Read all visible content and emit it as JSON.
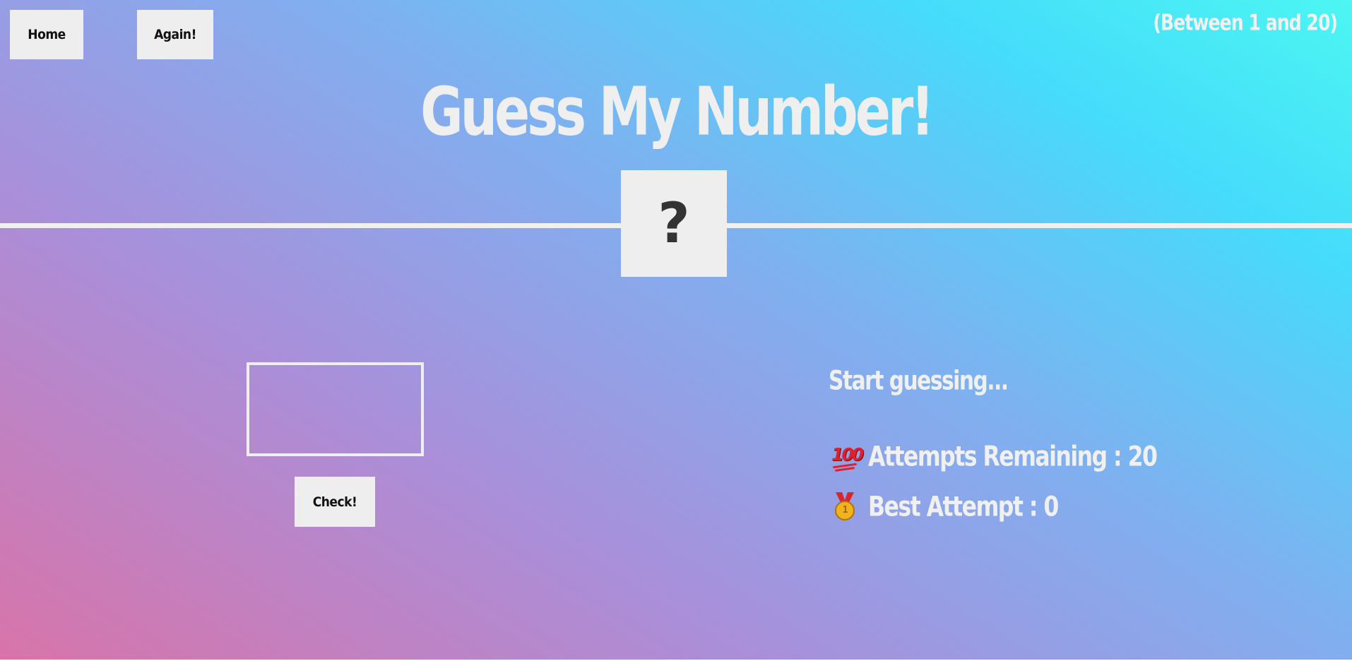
{
  "nav": {
    "home_label": "Home",
    "again_label": "Again!"
  },
  "range_hint": "(Between 1 and 20)",
  "title": "Guess My Number!",
  "secret_display": "?",
  "guess_input": {
    "value": "",
    "placeholder": ""
  },
  "check_label": "Check!",
  "message": "Start guessing...",
  "stats": {
    "attempts_icon": "hundred-points-icon",
    "attempts_text": "Attempts Remaining : 20",
    "best_icon": "medal-icon",
    "best_text": "Best Attempt : 0"
  },
  "colors": {
    "gradient_pink": "#d874a9",
    "gradient_purple": "#a98fda",
    "gradient_blue": "#7fb0f0",
    "gradient_cyan": "#45dcfb",
    "panel": "#eeeeee",
    "text_light": "#f0f0f0"
  }
}
